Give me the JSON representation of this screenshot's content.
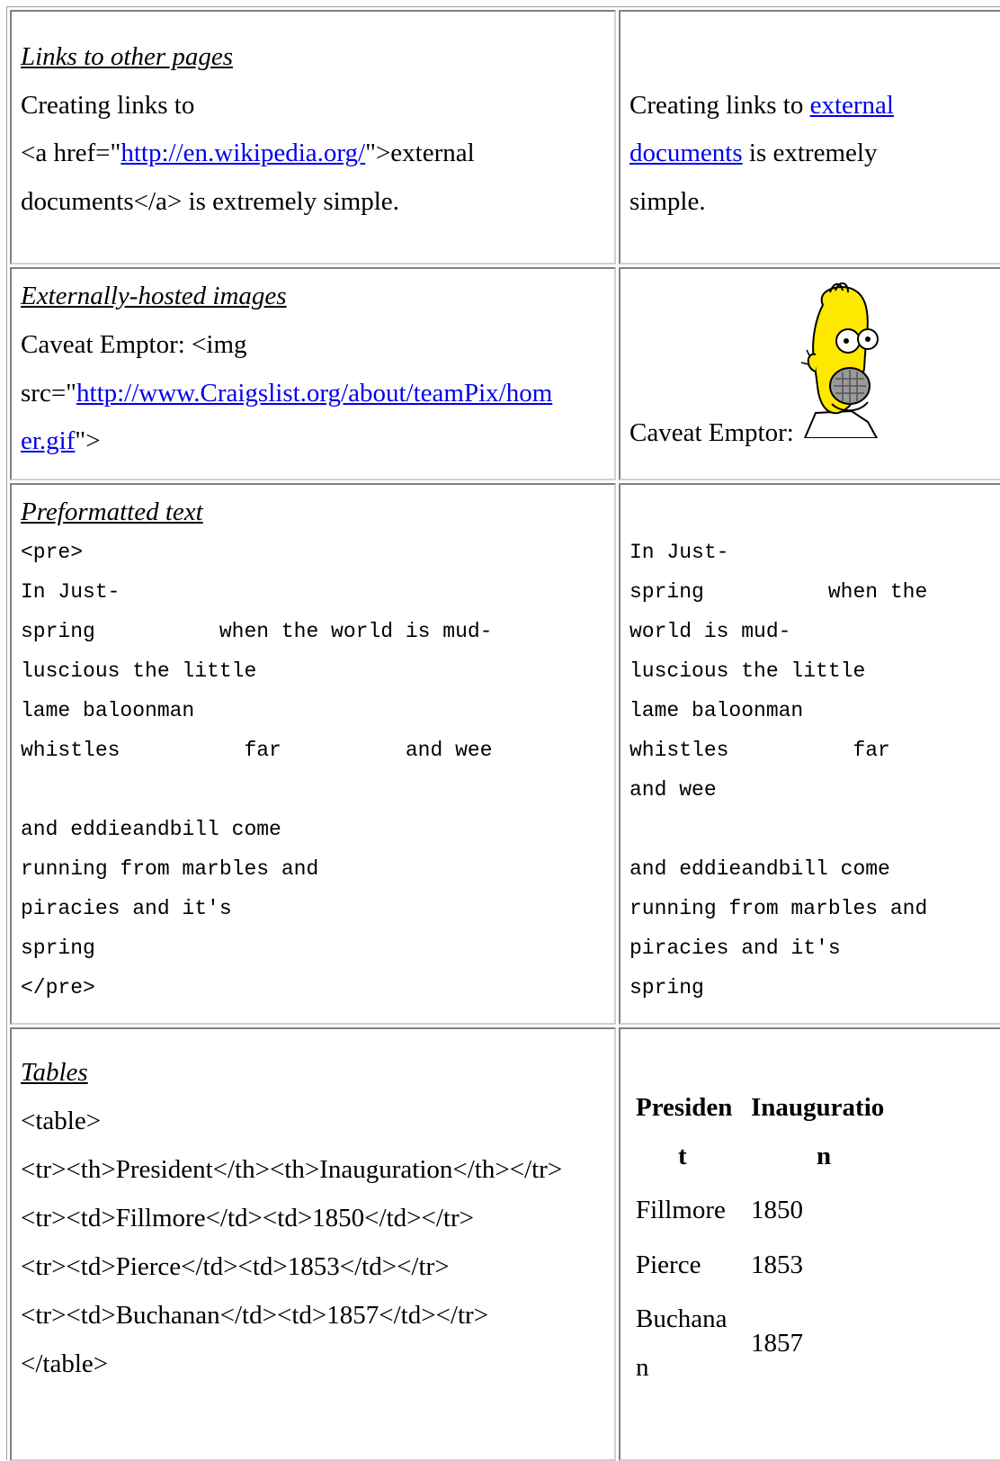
{
  "row1": {
    "heading": "Links to other pages",
    "src_line1": "Creating links to",
    "src_line2_a": "<a href=\"",
    "src_line2_link": "http://en.wikipedia.org/",
    "src_line2_b": "\">external",
    "src_line3": "documents</a> is extremely simple.",
    "render_pre": "Creating links to ",
    "render_link1": "external",
    "render_link2": "documents",
    "render_post": " is extremely",
    "render_line3": "simple."
  },
  "row2": {
    "heading": "Externally-hosted images",
    "src_line1": "Caveat Emptor: <img",
    "src_line2_a": "src=\"",
    "src_line2_link": "http://www.Craigslist.org/about/teamPix/hom",
    "src_line3_link": "er.gif",
    "src_line3_b": "\">",
    "render_text": "Caveat Emptor:",
    "image_icon": "homer-simpson-icon"
  },
  "row3": {
    "heading": "Preformatted text",
    "src_lines": [
      "<pre>",
      "In Just-",
      "spring          when the world is mud-",
      "luscious the little",
      "lame baloonman",
      "whistles          far          and wee",
      "",
      "and eddieandbill come",
      "running from marbles and",
      "piracies and it's",
      "spring",
      "</pre>"
    ],
    "render_lines": [
      "In Just-",
      "spring          when the",
      "world is mud-",
      "luscious the little",
      "lame baloonman",
      "whistles          far",
      "and wee",
      "",
      "and eddieandbill come",
      "running from marbles and",
      "piracies and it's",
      "spring"
    ]
  },
  "row4": {
    "heading": "Tables",
    "src_lines": [
      "<table>",
      "<tr><th>President</th><th>Inauguration</th></tr>",
      "<tr><td>Fillmore</td><td>1850</td></tr>",
      "<tr><td>Pierce</td><td>1853</td></tr>",
      "<tr><td>Buchanan</td><td>1857</td></tr>",
      "</table>"
    ],
    "th1_a": "Presiden",
    "th1_b": "t",
    "th2_a": "Inauguratio",
    "th2_b": "n",
    "r1c1": "Fillmore",
    "r1c2": "1850",
    "r2c1": "Pierce",
    "r2c2": "1853",
    "r3c1_a": "Buchana",
    "r3c1_b": "n",
    "r3c2": "1857"
  }
}
